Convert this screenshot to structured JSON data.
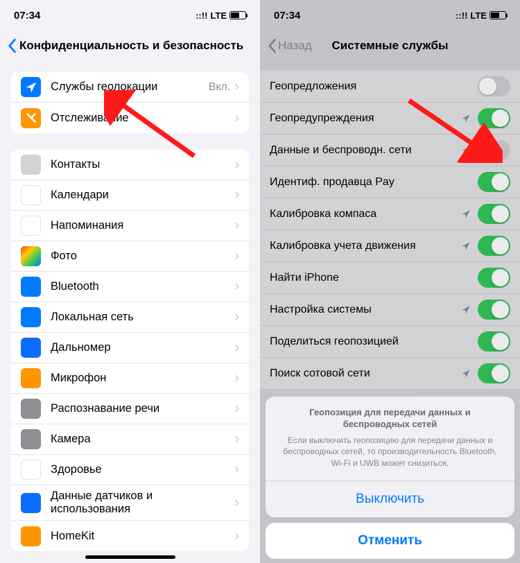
{
  "status": {
    "time": "07:34",
    "network": "LTE"
  },
  "left": {
    "title": "Конфиденциальность и безопасность",
    "group1": [
      {
        "label": "Службы геолокации",
        "value": "Вкл.",
        "icon": "ic-blue"
      },
      {
        "label": "Отслеживание",
        "icon": "ic-orange"
      }
    ],
    "group2": [
      {
        "label": "Контакты",
        "icon": "ic-gray"
      },
      {
        "label": "Календари",
        "icon": "ic-white"
      },
      {
        "label": "Напоминания",
        "icon": "ic-white"
      },
      {
        "label": "Фото",
        "icon": "ic-multi"
      },
      {
        "label": "Bluetooth",
        "icon": "ic-blue"
      },
      {
        "label": "Локальная сеть",
        "icon": "ic-blue"
      },
      {
        "label": "Дальномер",
        "icon": "ic-blue2"
      },
      {
        "label": "Микрофон",
        "icon": "ic-orange"
      },
      {
        "label": "Распознавание речи",
        "icon": "ic-darkgray"
      },
      {
        "label": "Камера",
        "icon": "ic-darkgray"
      },
      {
        "label": "Здоровье",
        "icon": "ic-white"
      },
      {
        "label": "Данные датчиков и использования",
        "icon": "ic-blue2"
      },
      {
        "label": "HomeKit",
        "icon": "ic-orange"
      }
    ]
  },
  "right": {
    "back": "Назад",
    "title": "Системные службы",
    "items": [
      {
        "label": "Геопредложения",
        "on": false,
        "arrow": false
      },
      {
        "label": "Геопредупреждения",
        "on": true,
        "arrow": true
      },
      {
        "label": "Данные и беспроводн. сети",
        "on": false,
        "arrow": true
      },
      {
        "label": "Идентиф. продавца Pay",
        "on": true,
        "arrow": false,
        "apple": true
      },
      {
        "label": "Калибровка компаса",
        "on": true,
        "arrow": true
      },
      {
        "label": "Калибровка учета движения",
        "on": true,
        "arrow": true
      },
      {
        "label": "Найти iPhone",
        "on": true,
        "arrow": false
      },
      {
        "label": "Настройка системы",
        "on": true,
        "arrow": true
      },
      {
        "label": "Поделиться геопозицией",
        "on": true,
        "arrow": false
      },
      {
        "label": "Поиск сотовой сети",
        "on": true,
        "arrow": true
      }
    ],
    "footer": "СОВЕРШЕНСТВОВАНИЕ ПРОДУКТА",
    "alert": {
      "title": "Геопозиция для передачи данных и беспроводных сетей",
      "message": "Если выключить геопозицию для передачи данных и беспроводных сетей, то производительность Bluetooth, Wi-Fi и UWB может снизиться.",
      "disable": "Выключить",
      "cancel": "Отменить"
    }
  }
}
